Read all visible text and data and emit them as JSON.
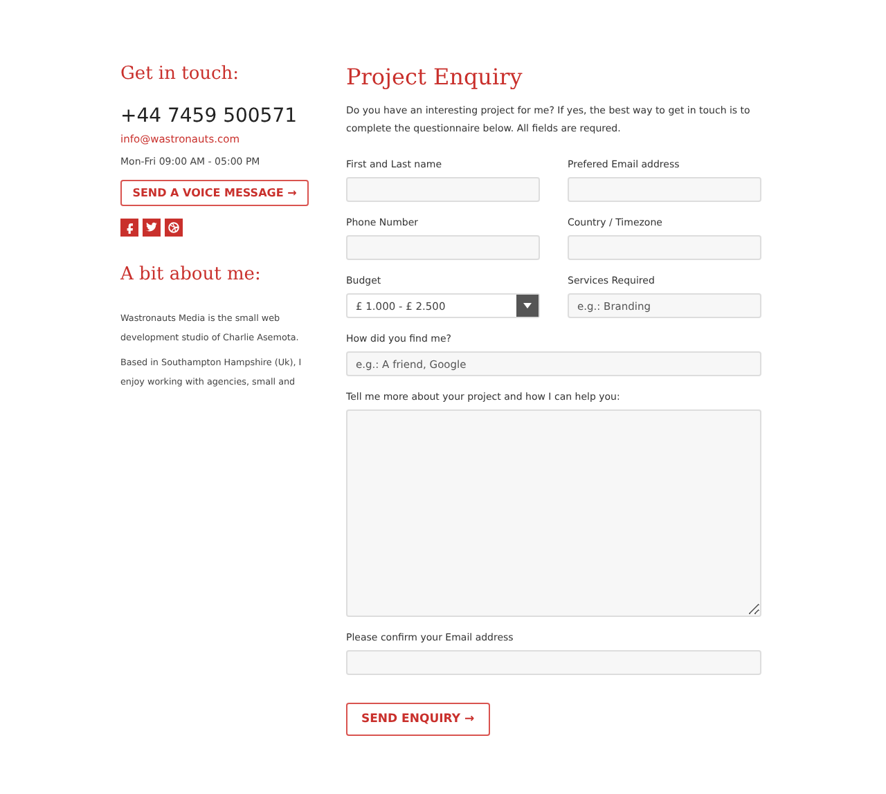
{
  "contact": {
    "heading": "Get in touch:",
    "phone": "+44 7459 500571",
    "email": "info@wastronauts.com",
    "hours": "Mon-Fri 09:00 AM - 05:00 PM",
    "voice_button": "SEND A VOICE MESSAGE →",
    "social": [
      {
        "kind": "facebook"
      },
      {
        "kind": "twitter"
      },
      {
        "kind": "dribbble"
      }
    ],
    "about_heading": "A bit about me:",
    "about": [
      "Wastronauts Media is the small web development studio of Charlie Asemota.",
      "Based in Southampton Hampshire (Uk), I enjoy working with agencies, small and"
    ]
  },
  "enquiry": {
    "title": "Project Enquiry",
    "intro": "Do you have an interesting project for me? If yes, the best way to get in touch is to complete the questionnaire below. All fields are requred.",
    "rows": [
      [
        {
          "kind": "text",
          "label": "First and Last name"
        },
        {
          "kind": "text",
          "label": "Prefered Email address"
        }
      ],
      [
        {
          "kind": "text",
          "label": "Phone Number"
        },
        {
          "kind": "text",
          "label": "Country / Timezone"
        }
      ],
      [
        {
          "kind": "select",
          "label": "Budget",
          "value": "£ 1.000 - £ 2.500"
        },
        {
          "kind": "text",
          "label": "Services Required",
          "placeholder": "e.g.: Branding"
        }
      ],
      [
        {
          "kind": "text",
          "label": "How did you find me?",
          "placeholder": "e.g.: A friend, Google"
        }
      ],
      [
        {
          "kind": "textarea",
          "label": "Tell me more about your project and how I can help you:"
        }
      ],
      [
        {
          "kind": "text",
          "label": "Please confirm your Email address"
        }
      ]
    ],
    "submit": "SEND ENQUIRY →"
  }
}
